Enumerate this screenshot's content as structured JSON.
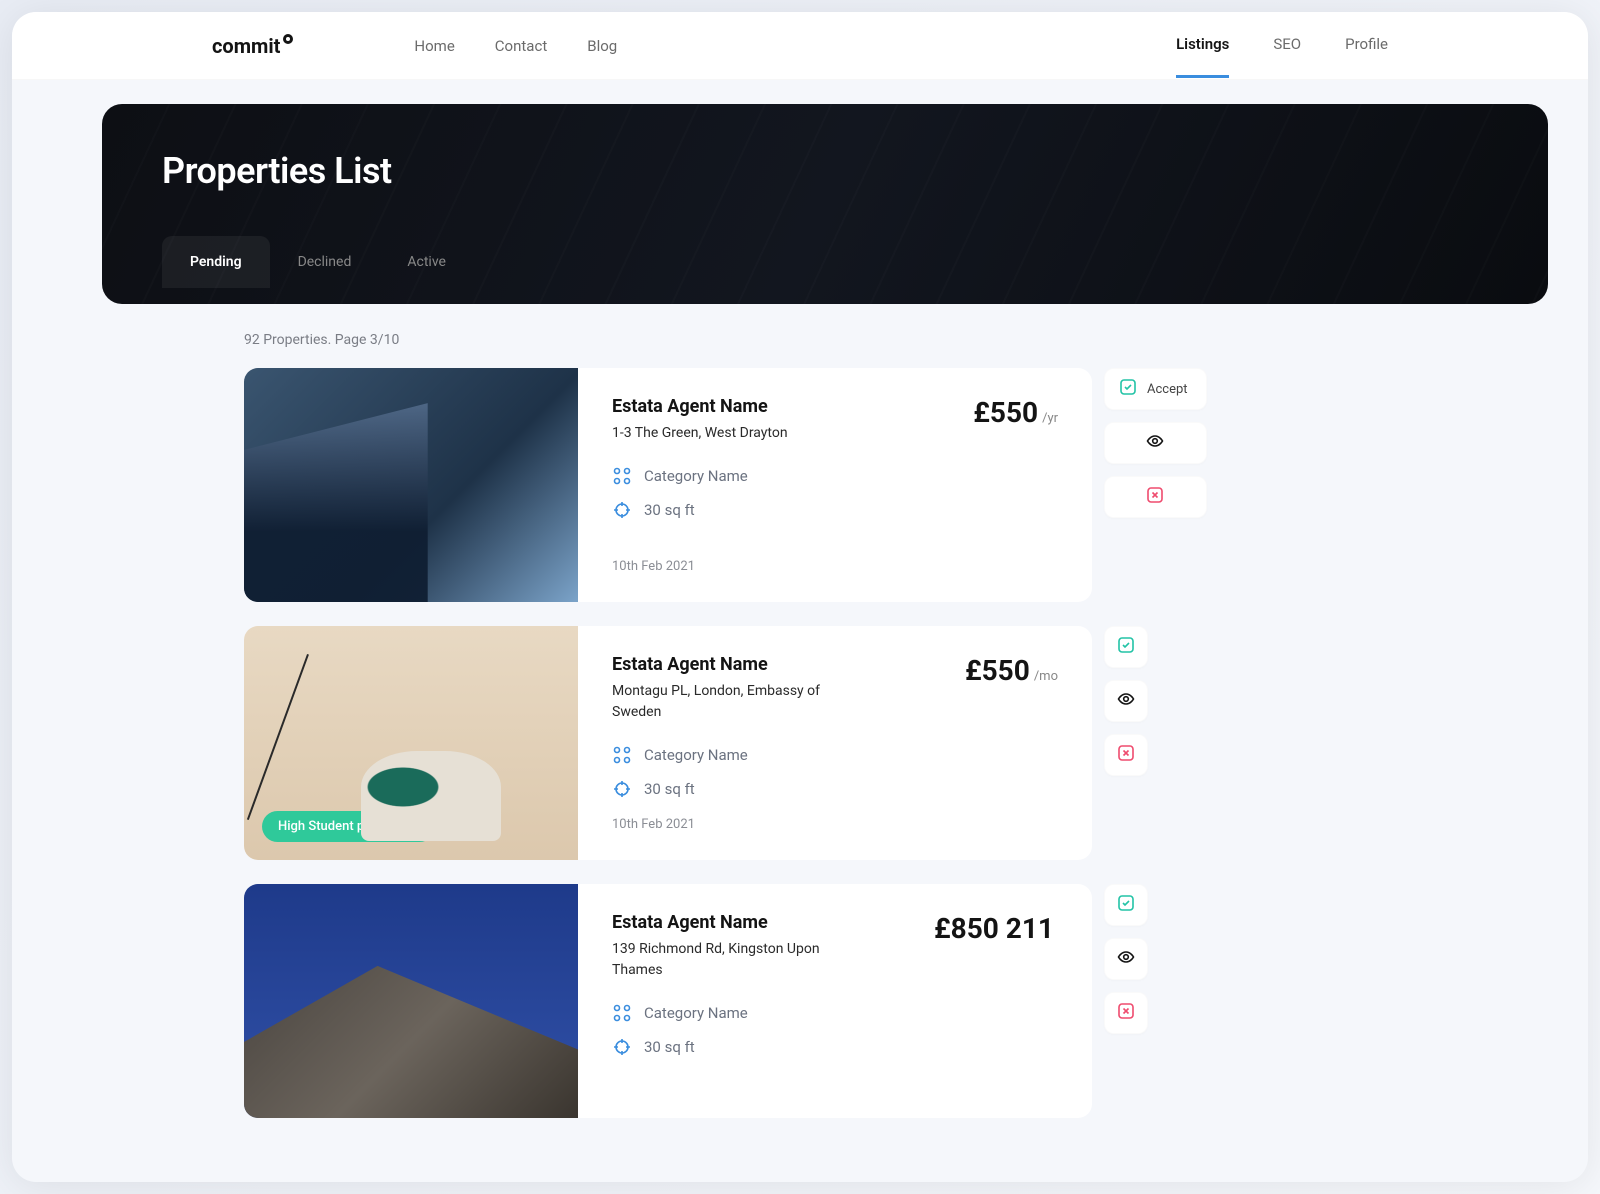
{
  "brand": "commit",
  "nav": {
    "left": [
      "Home",
      "Contact",
      "Blog"
    ],
    "right": [
      "Listings",
      "SEO",
      "Profile"
    ],
    "active_right": "Listings"
  },
  "hero": {
    "title": "Properties List",
    "tabs": [
      "Pending",
      "Declined",
      "Active"
    ],
    "active_tab": "Pending"
  },
  "summary": "92 Properties. Page 3/10",
  "accept_label": "Accept",
  "listings": [
    {
      "agent": "Estata Agent Name",
      "address": "1-3 The Green, West Drayton",
      "price": "£550",
      "unit": "/yr",
      "category": "Category Name",
      "area": "30 sq ft",
      "date": "10th Feb 2021",
      "badge": null,
      "show_accept_label": true,
      "img": "img1"
    },
    {
      "agent": "Estata Agent Name",
      "address": "Montagu PL, London, Embassy of Sweden",
      "price": "£550",
      "unit": "/mo",
      "category": "Category Name",
      "area": "30 sq ft",
      "date": "10th Feb 2021",
      "badge": "High Student population",
      "show_accept_label": false,
      "img": "img2"
    },
    {
      "agent": "Estata Agent Name",
      "address": "139 Richmond Rd, Kingston Upon Thames",
      "price": "£850 211",
      "unit": "",
      "category": "Category Name",
      "area": "30 sq ft",
      "date": "",
      "badge": null,
      "show_accept_label": false,
      "img": "img3"
    }
  ]
}
